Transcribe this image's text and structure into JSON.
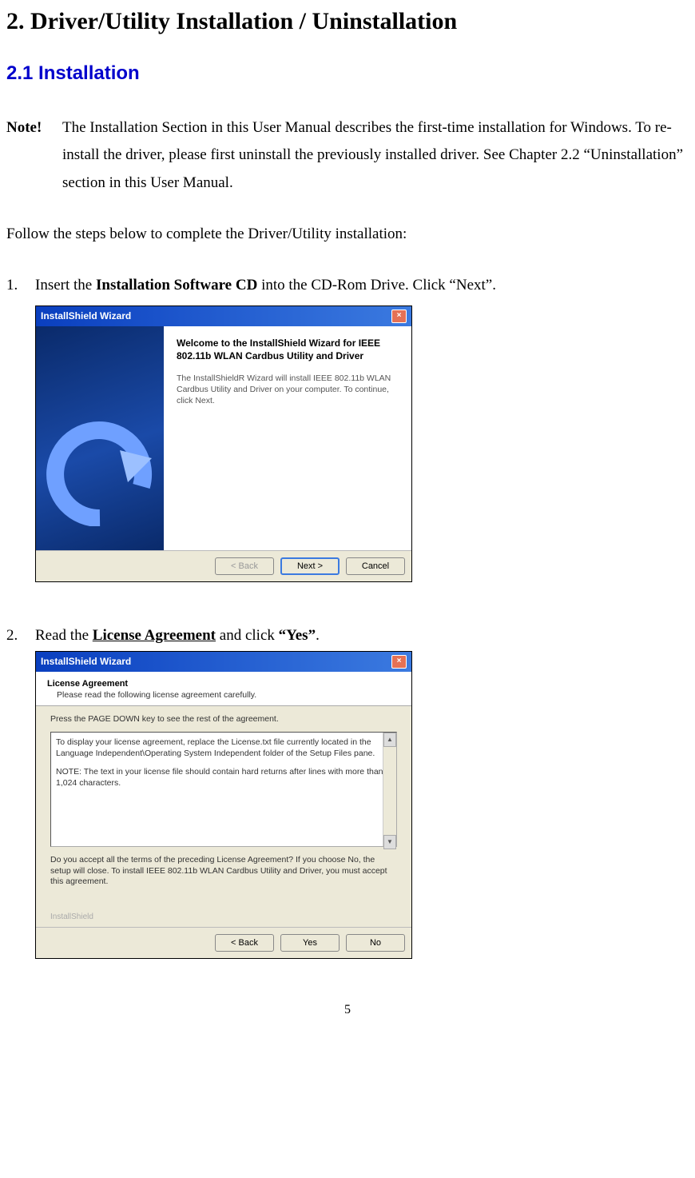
{
  "doc": {
    "h1": "2. Driver/Utility Installation / Uninstallation",
    "h2": "2.1 Installation",
    "note_label": "Note!",
    "note_body": "The Installation Section in this User Manual describes the first-time installation for Windows. To re-install the driver, please first uninstall the previously installed driver. See Chapter 2.2 “Uninstallation” section in this User Manual.",
    "follow": "Follow the steps below to complete the Driver/Utility installation:",
    "step1_num": "1.",
    "step1_a": "Insert the ",
    "step1_b": "Installation Software CD",
    "step1_c": " into the CD-Rom Drive. Click “Next”.",
    "step2_num": "2.",
    "step2_a": "Read the ",
    "step2_b": "License Agreement",
    "step2_c": " and click ",
    "step2_d": "“Yes”",
    "step2_e": ".",
    "page_num": "5"
  },
  "wiz1": {
    "title": "InstallShield Wizard",
    "heading": "Welcome to the InstallShield Wizard for IEEE 802.11b WLAN Cardbus Utility and Driver",
    "desc": "The InstallShieldR Wizard will install IEEE 802.11b WLAN Cardbus Utility and Driver on your computer.  To continue, click Next.",
    "btn_back": "< Back",
    "btn_next": "Next >",
    "btn_cancel": "Cancel"
  },
  "wiz2": {
    "title": "InstallShield Wizard",
    "header_title": "License Agreement",
    "header_sub": "Please read the following license agreement carefully.",
    "instr": "Press the PAGE DOWN key to see the rest of the agreement.",
    "lic_p1": "To display your license agreement, replace the License.txt file currently located in the Language Independent\\Operating System Independent folder of the Setup Files pane.",
    "lic_p2": "NOTE: The text in your license file should contain hard returns after lines with more than 1,024 characters.",
    "accept": "Do you accept all the terms of the preceding License Agreement?  If you choose No, the setup will close.  To install IEEE 802.11b WLAN Cardbus Utility and Driver, you must accept this agreement.",
    "brand": "InstallShield",
    "btn_back": "< Back",
    "btn_yes": "Yes",
    "btn_no": "No"
  }
}
